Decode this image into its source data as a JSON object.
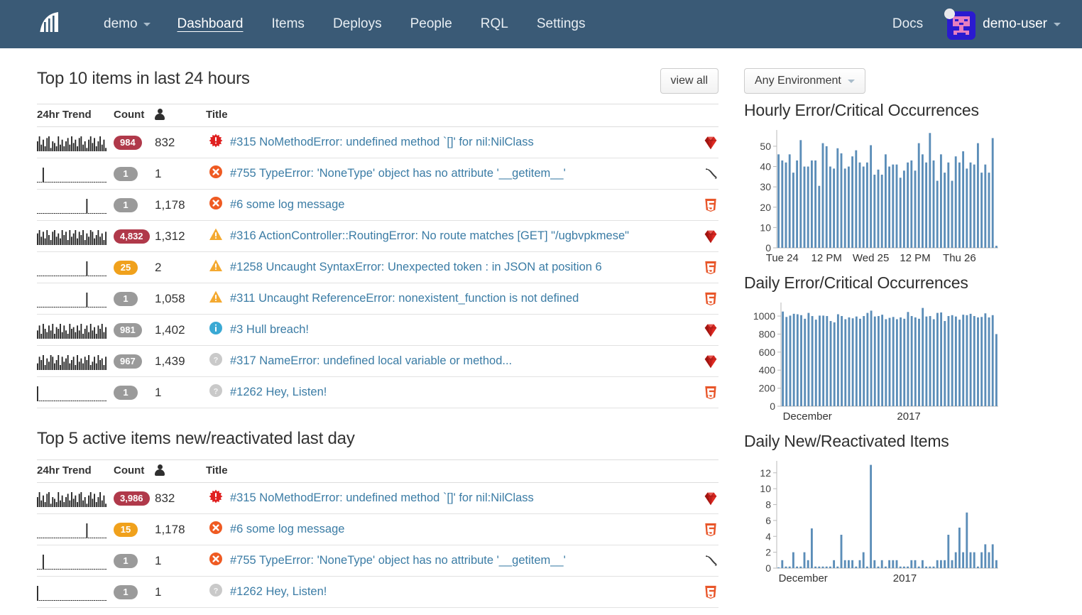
{
  "navbar": {
    "logo_icon": "rollbar-logo-icon",
    "project": {
      "label": "demo",
      "caret_icon": "chevron-down-icon"
    },
    "links": [
      {
        "label": "Dashboard",
        "active": true
      },
      {
        "label": "Items",
        "active": false
      },
      {
        "label": "Deploys",
        "active": false
      },
      {
        "label": "People",
        "active": false
      },
      {
        "label": "RQL",
        "active": false
      },
      {
        "label": "Settings",
        "active": false
      }
    ],
    "docs_label": "Docs",
    "user": {
      "name": "demo-user",
      "avatar_icon": "robot-avatar-icon",
      "caret_icon": "chevron-down-icon"
    }
  },
  "main": {
    "section1": {
      "title": "Top 10 items in last 24 hours",
      "view_all_label": "view all",
      "columns": [
        "24hr Trend",
        "Count",
        "users-icon",
        "Title"
      ],
      "rows": [
        {
          "trend": [
            6,
            9,
            4,
            7,
            3,
            8,
            9,
            2,
            6,
            5,
            3,
            9,
            4,
            7,
            3,
            6,
            8,
            4,
            9,
            5,
            7,
            3,
            8,
            9,
            4,
            6,
            2,
            7,
            9,
            5,
            8,
            3,
            6,
            9,
            4,
            7,
            2
          ],
          "count": "984",
          "count_color": "red",
          "users": "832",
          "level": "critical",
          "title": "#315 NoMethodError: undefined method `[]' for nil:NilClass",
          "platform": "ruby"
        },
        {
          "trend": [
            0,
            0,
            0,
            9,
            0,
            0,
            0,
            0,
            0,
            0,
            0,
            0,
            0,
            0,
            0,
            0,
            0,
            0,
            0,
            0,
            0,
            0,
            0,
            0,
            0,
            0,
            0,
            0,
            0,
            0,
            0,
            0,
            0,
            0,
            0,
            0,
            0
          ],
          "count": "1",
          "count_color": "gray",
          "users": "1",
          "level": "error",
          "title": "#755 TypeError: 'NoneType' object has no attribute '__getitem__'",
          "platform": "python"
        },
        {
          "trend": [
            0,
            0,
            0,
            0,
            0,
            0,
            0,
            0,
            0,
            0,
            0,
            0,
            0,
            0,
            0,
            0,
            0,
            0,
            0,
            0,
            0,
            0,
            0,
            0,
            0,
            0,
            9,
            0,
            0,
            0,
            0,
            0,
            0,
            0,
            0,
            0,
            0
          ],
          "count": "1",
          "count_color": "gray",
          "users": "1,178",
          "level": "error",
          "title": "#6 some log message",
          "platform": "html5"
        },
        {
          "trend": [
            7,
            9,
            5,
            8,
            4,
            9,
            6,
            3,
            8,
            9,
            5,
            7,
            4,
            9,
            6,
            8,
            3,
            9,
            5,
            7,
            9,
            4,
            8,
            6,
            9,
            3,
            7,
            5,
            9,
            8,
            4,
            6,
            9,
            5,
            7,
            3,
            8
          ],
          "count": "4,832",
          "count_color": "red",
          "users": "1,312",
          "level": "warning",
          "title": "#316 ActionController::RoutingError: No route matches [GET] \"/ugbvpkmese\"",
          "platform": "ruby"
        },
        {
          "trend": [
            0,
            0,
            0,
            0,
            0,
            0,
            0,
            0,
            0,
            0,
            0,
            0,
            0,
            0,
            0,
            0,
            0,
            0,
            0,
            0,
            0,
            0,
            0,
            0,
            0,
            0,
            9,
            0,
            0,
            0,
            0,
            0,
            0,
            0,
            0,
            0,
            0
          ],
          "count": "25",
          "count_color": "orange",
          "users": "2",
          "level": "warning",
          "title": "#1258 Uncaught SyntaxError: Unexpected token : in JSON at position 6",
          "platform": "html5"
        },
        {
          "trend": [
            0,
            0,
            0,
            0,
            0,
            0,
            0,
            0,
            0,
            0,
            0,
            0,
            0,
            0,
            0,
            0,
            0,
            0,
            0,
            0,
            0,
            0,
            0,
            0,
            0,
            0,
            9,
            0,
            0,
            0,
            0,
            0,
            0,
            0,
            0,
            0,
            0
          ],
          "count": "1",
          "count_color": "gray",
          "users": "1,058",
          "level": "warning",
          "title": "#311 Uncaught ReferenceError: nonexistent_function is not defined",
          "platform": "html5"
        },
        {
          "trend": [
            5,
            8,
            3,
            9,
            6,
            4,
            8,
            5,
            9,
            3,
            7,
            6,
            9,
            4,
            8,
            5,
            3,
            9,
            6,
            7,
            4,
            8,
            5,
            9,
            3,
            6,
            8,
            4,
            9,
            5,
            7,
            3,
            8,
            6,
            9,
            4,
            7
          ],
          "count": "981",
          "count_color": "gray",
          "users": "1,402",
          "level": "info",
          "title": "#3 Hull breach!",
          "platform": "ruby"
        },
        {
          "trend": [
            4,
            8,
            6,
            9,
            3,
            7,
            5,
            9,
            8,
            4,
            6,
            9,
            3,
            8,
            5,
            7,
            9,
            4,
            6,
            8,
            3,
            9,
            5,
            7,
            4,
            8,
            6,
            9,
            3,
            5,
            8,
            4,
            9,
            6,
            7,
            3,
            8
          ],
          "count": "967",
          "count_color": "gray",
          "users": "1,439",
          "level": "debug",
          "title": "#317 NameError: undefined local variable or method...",
          "platform": "ruby"
        },
        {
          "trend": [
            9,
            0,
            0,
            0,
            0,
            0,
            0,
            0,
            0,
            0,
            0,
            0,
            0,
            0,
            0,
            0,
            0,
            0,
            0,
            0,
            0,
            0,
            0,
            0,
            0,
            0,
            0,
            0,
            0,
            0,
            0,
            0,
            0,
            0,
            0,
            0,
            0
          ],
          "count": "1",
          "count_color": "gray",
          "users": "1",
          "level": "debug",
          "title": "#1262 Hey, Listen!",
          "platform": "html5"
        }
      ]
    },
    "section2": {
      "title": "Top 5 active items new/reactivated last day",
      "columns": [
        "24hr Trend",
        "Count",
        "users-icon",
        "Title"
      ],
      "rows": [
        {
          "trend": [
            6,
            9,
            4,
            7,
            3,
            8,
            9,
            2,
            6,
            5,
            3,
            9,
            4,
            7,
            3,
            6,
            8,
            4,
            9,
            5,
            7,
            3,
            8,
            9,
            4,
            6,
            2,
            7,
            9,
            5,
            8,
            3,
            6,
            9,
            4,
            7,
            2
          ],
          "count": "3,986",
          "count_color": "red",
          "users": "832",
          "level": "critical",
          "title": "#315 NoMethodError: undefined method `[]' for nil:NilClass",
          "platform": "ruby"
        },
        {
          "trend": [
            0,
            0,
            0,
            0,
            0,
            0,
            0,
            0,
            0,
            0,
            0,
            0,
            0,
            0,
            0,
            0,
            0,
            0,
            0,
            0,
            0,
            0,
            0,
            0,
            0,
            0,
            9,
            0,
            0,
            0,
            0,
            0,
            0,
            0,
            0,
            0,
            0
          ],
          "count": "15",
          "count_color": "orange",
          "users": "1,178",
          "level": "error",
          "title": "#6 some log message",
          "platform": "html5"
        },
        {
          "trend": [
            0,
            0,
            0,
            9,
            0,
            0,
            0,
            0,
            0,
            0,
            0,
            0,
            0,
            0,
            0,
            0,
            0,
            0,
            0,
            0,
            0,
            0,
            0,
            0,
            0,
            0,
            0,
            0,
            0,
            0,
            0,
            0,
            0,
            0,
            0,
            0,
            0
          ],
          "count": "1",
          "count_color": "gray",
          "users": "1",
          "level": "error",
          "title": "#755 TypeError: 'NoneType' object has no attribute '__getitem__'",
          "platform": "python"
        },
        {
          "trend": [
            9,
            0,
            0,
            0,
            0,
            0,
            0,
            0,
            0,
            0,
            0,
            0,
            0,
            0,
            0,
            0,
            0,
            0,
            0,
            0,
            0,
            0,
            0,
            0,
            0,
            0,
            0,
            0,
            0,
            0,
            0,
            0,
            0,
            0,
            0,
            0,
            0
          ],
          "count": "1",
          "count_color": "gray",
          "users": "1",
          "level": "debug",
          "title": "#1262 Hey, Listen!",
          "platform": "html5"
        }
      ]
    }
  },
  "sidebar": {
    "environment_filter": {
      "label": "Any Environment",
      "caret_icon": "chevron-down-icon"
    }
  },
  "colors": {
    "navbar_bg": "#3a5a76",
    "link": "#3b7ca5",
    "bar": "#5b8db8",
    "badge_red": "#b0394a",
    "badge_gray": "#9a9a9a",
    "badge_orange": "#f0a11c"
  },
  "chart_data": [
    {
      "type": "bar",
      "title": "Hourly Error/Critical Occurrences",
      "xlabel": "",
      "ylabel": "",
      "ylim": [
        0,
        58
      ],
      "yticks": [
        0,
        10,
        20,
        30,
        40,
        50
      ],
      "tick_labels": [
        "Tue 24",
        "12 PM",
        "Wed 25",
        "12 PM",
        "Thu 26"
      ],
      "tick_positions": [
        1,
        13,
        25,
        37,
        49
      ],
      "grid": false,
      "legend": "none",
      "values": [
        46,
        43,
        42,
        46,
        37,
        43,
        53,
        40,
        40,
        43,
        43,
        30.5,
        51.5,
        50,
        40,
        39,
        49,
        46.5,
        39,
        40,
        45,
        48,
        42,
        40,
        42,
        50.5,
        36,
        38.5,
        36,
        46,
        40,
        41,
        41,
        34.5,
        38,
        42,
        43,
        38,
        51.5,
        46,
        42,
        56.5,
        43,
        33,
        46,
        37,
        42,
        33,
        45,
        42,
        47.5,
        39,
        42,
        41,
        51.5,
        37,
        41,
        37,
        54,
        1
      ]
    },
    {
      "type": "bar",
      "title": "Daily Error/Critical Occurrences",
      "xlabel": "",
      "ylabel": "",
      "ylim": [
        0,
        1150
      ],
      "yticks": [
        0,
        200,
        400,
        600,
        800,
        1000
      ],
      "tick_labels": [
        "December",
        "2017"
      ],
      "tick_positions": [
        0,
        31
      ],
      "grid": false,
      "legend": "none",
      "values": [
        1050,
        990,
        1005,
        1025,
        1020,
        1010,
        970,
        1035,
        1000,
        960,
        1005,
        1005,
        1000,
        945,
        930,
        1020,
        1000,
        965,
        985,
        975,
        995,
        970,
        1000,
        1035,
        1060,
        995,
        1000,
        1015,
        965,
        980,
        990,
        965,
        985,
        970,
        1045,
        1000,
        985,
        970,
        1090,
        995,
        1000,
        965,
        1035,
        1040,
        945,
        1000,
        1010,
        995,
        960,
        1015,
        1010,
        1025,
        1000,
        985,
        990,
        1030,
        985,
        1010,
        800
      ]
    },
    {
      "type": "bar",
      "title": "Daily New/Reactivated Items",
      "xlabel": "",
      "ylabel": "",
      "ylim": [
        0,
        13.5
      ],
      "yticks": [
        0,
        2,
        4,
        6,
        8,
        10,
        12
      ],
      "tick_labels": [
        "December",
        "2017"
      ],
      "tick_positions": [
        0,
        31
      ],
      "grid": false,
      "legend": "none",
      "values": [
        0,
        1,
        0.2,
        0.2,
        2,
        0.2,
        0.2,
        2,
        1,
        5,
        0.2,
        0.2,
        0.2,
        0.2,
        0.2,
        1,
        0.2,
        4.2,
        1,
        1,
        1,
        0.2,
        1,
        2,
        0.2,
        13,
        1,
        0.2,
        1,
        0.2,
        1,
        1,
        1,
        0.2,
        0.2,
        0.2,
        1,
        1,
        0.2,
        1,
        0.2,
        0.2,
        0.2,
        1,
        1,
        1,
        4.2,
        1,
        2,
        5.1,
        2,
        7,
        2,
        2,
        0.2,
        2,
        3,
        2,
        3,
        1
      ]
    }
  ]
}
